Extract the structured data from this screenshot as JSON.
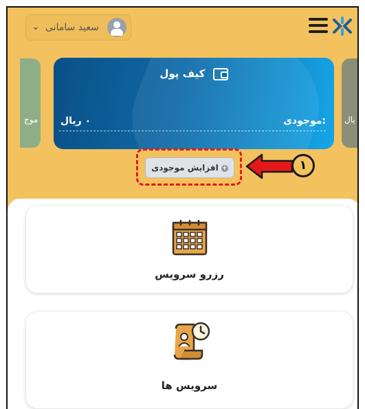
{
  "header": {
    "user_name": "سعید سامانی",
    "chevron": "chevron-down-icon",
    "menu_icon": "hamburger-menu-icon",
    "logo_icon": "brand-logo-icon"
  },
  "side_cards": {
    "left_text": "موج",
    "right_text": "یال"
  },
  "wallet": {
    "title": "کیف پول",
    "balance_label": "موجودی:",
    "balance_value": "۰ ریال"
  },
  "increase_button": {
    "label": "افزایش موجودی"
  },
  "annotation": {
    "number": "۱",
    "highlight_color": "#e41818"
  },
  "services": [
    {
      "title": "رزرو سرویس",
      "icon": "calendar-icon"
    },
    {
      "title": "سرویس ها",
      "icon": "service-document-clock-icon"
    }
  ],
  "colors": {
    "background": "#f3c25f",
    "wallet_start": "#0b4f86",
    "wallet_end": "#16a6e7"
  }
}
